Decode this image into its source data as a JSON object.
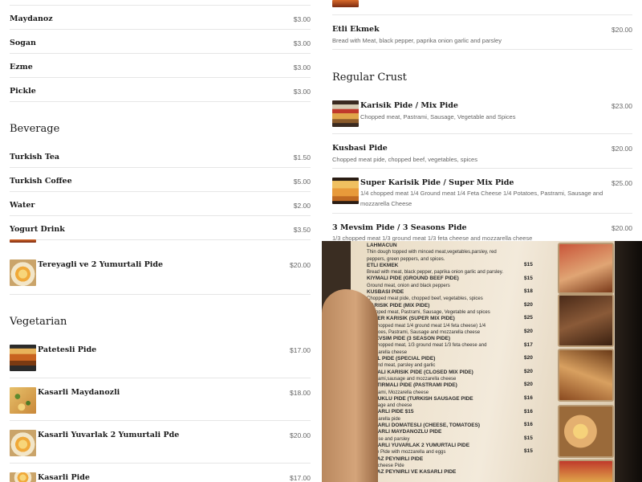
{
  "left": {
    "extras": [
      {
        "name": "Maydanoz",
        "price": "$3.00"
      },
      {
        "name": "Sogan",
        "price": "$3.00"
      },
      {
        "name": "Ezme",
        "price": "$3.00"
      },
      {
        "name": "Pickle",
        "price": "$3.00"
      }
    ],
    "beverage_title": "Beverage",
    "beverages": [
      {
        "name": "Turkish Tea",
        "price": "$1.50"
      },
      {
        "name": "Turkish Coffee",
        "price": "$5.00"
      },
      {
        "name": "Water",
        "price": "$2.00"
      },
      {
        "name": "Yogurt Drink",
        "price": "$3.50"
      }
    ],
    "tereyagli": {
      "name": "Tereyagli ve 2 Yumurtali Pide",
      "price": "$20.00"
    },
    "vegetarian_title": "Vegetarian",
    "vegetarian": [
      {
        "name": "Patetesli Pide",
        "price": "$17.00"
      },
      {
        "name": "Kasarli Maydanozli",
        "price": "$18.00"
      },
      {
        "name": "Kasarli Yuvarlak 2 Yumurtali Pde",
        "price": "$20.00"
      },
      {
        "name": "Kasarli Pide",
        "price": "$17.00"
      }
    ]
  },
  "right": {
    "etli": {
      "name": "Etli Ekmek",
      "desc": "Bread with Meat, black pepper, paprika onion garlic and parsley",
      "price": "$20.00"
    },
    "regular_title": "Regular Crust",
    "karisik": {
      "name": "Karisik Pide / Mix Pide",
      "desc": "Chopped meat, Pastrami, Sausage, Vegetable and Spices",
      "price": "$23.00"
    },
    "kusbasi": {
      "name": "Kusbasi Pide",
      "desc": "Chopped meat pide, chopped beef, vegetables, spices",
      "price": "$20.00"
    },
    "super": {
      "name": "Super Karisik Pide / Super Mix Pide",
      "desc": "1/4 chopped meat 1/4 Ground meat 1/4 Feta Cheese 1/4 Potatoes, Pastrami, Sausage and mozzarella Cheese",
      "price": "$25.00"
    },
    "mevsim": {
      "name": "3 Mevsim Pide / 3 Seasons Pide",
      "desc": "1/3 chopped meat 1/3 ground meat 1/3 feta cheese and mozzarella cheese",
      "price": "$20.00"
    }
  },
  "photo": {
    "lines": [
      {
        "t": "LAHMACUN",
        "b": true
      },
      {
        "t": "Thin dough topped with minced meat,vegetables,parsley, red",
        "b": false
      },
      {
        "t": "peppers, green peppers, and spices.",
        "b": false
      },
      {
        "t": "ETLI EKMEK",
        "b": true
      },
      {
        "t": "Bread with meat, black pepper, paprika onion garlic and parsley.",
        "b": false
      },
      {
        "t": "KIYMALI PIDE (GROUND BEEF PIDE)",
        "b": true
      },
      {
        "t": "Ground meat, onion and black peppers",
        "b": false
      },
      {
        "t": "KUSBASI PIDE",
        "b": true
      },
      {
        "t": "Chopped meat pide, chopped beef, vegetables, spices",
        "b": false
      },
      {
        "t": "KARISIK PIDE (MIX PIDE)",
        "b": true
      },
      {
        "t": "Chopped meat, Pastrami, Sausage, Vegetable and spices",
        "b": false
      },
      {
        "t": "SUPER KARISIK (SUPER MIX PIDE)",
        "b": true
      },
      {
        "t": "1/4 chopped meat 1/4 ground meat 1/4 feta cheese) 1/4",
        "b": false
      },
      {
        "t": "Potatoes, Pastrami, Sausage and mozzarella cheese",
        "b": false
      },
      {
        "t": "3 MEVSIM PIDE (3 SEASON PIDE)",
        "b": true
      },
      {
        "t": "1/3 chopped meat, 1/3 ground meat 1/3 feta cheese and",
        "b": false
      },
      {
        "t": "mozzarella cheese",
        "b": false
      },
      {
        "t": "ÖZEL PIDE (SPECIAL PIDE)",
        "b": true
      },
      {
        "t": "Ground meat, parsley and garlic",
        "b": false
      },
      {
        "t": "KAPALI KARISIK PIDE (CLOSED MIX PIDE)",
        "b": true
      },
      {
        "t": "Pastrami,sausage and mozzarella cheese",
        "b": false
      },
      {
        "t": "PASTIRMALI PIDE (PASTRAMI PIDE)",
        "b": true
      },
      {
        "t": "Pastrami, Mozzarella cheese",
        "b": false
      },
      {
        "t": "SUCUKLU PIDE (TURKISH SAUSAGE PIDE",
        "b": true
      },
      {
        "t": "Sausage and cheese",
        "b": false
      },
      {
        "t": "KASARLI PIDE $15",
        "b": true
      },
      {
        "t": "Mozzarella pide",
        "b": false
      },
      {
        "t": "KASARLI DOMATESLI (CHEESE, TOMATOES)",
        "b": true
      },
      {
        "t": "KASARLI MAYDANOZLU PIDE",
        "b": true
      },
      {
        "t": "Cheese and parsley",
        "b": false
      },
      {
        "t": "KASARLI YUVARLAK 2 YUMURTALI PIDE",
        "b": true
      },
      {
        "t": "Circle Pide with mozzarella and eggs",
        "b": false
      },
      {
        "t": "BEYAZ PEYNIRLI PIDE",
        "b": true
      },
      {
        "t": "Feta cheese Pide",
        "b": false
      },
      {
        "t": "BEYAZ PEYNIRLI VE KASARLI PIDE",
        "b": true
      }
    ],
    "prices": [
      "$15",
      "$15",
      "$18",
      "$20",
      "$25",
      "$20",
      "$17",
      "$20",
      "$20",
      "$20",
      "$16",
      "$16",
      "$16",
      "$15",
      "$15"
    ]
  }
}
